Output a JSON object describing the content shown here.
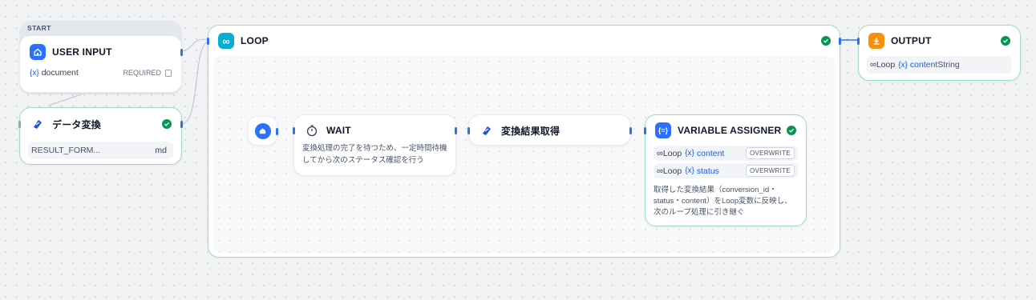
{
  "start_group": {
    "label": "START"
  },
  "user_input": {
    "title": "USER INPUT",
    "icon": "home-icon",
    "color": "#2970ff",
    "variable": "document",
    "variable_icon": "{x}",
    "required_label": "REQUIRED"
  },
  "data_convert": {
    "title": "データ変換",
    "icon": "tool-icon",
    "field_label": "RESULT_FORM...",
    "field_value": "md",
    "status": "success"
  },
  "loop": {
    "title": "LOOP",
    "icon": "infinity-icon",
    "color": "#06aed4",
    "status": "success"
  },
  "loop_start": {
    "icon": "home-icon"
  },
  "wait": {
    "title": "WAIT",
    "icon": "stopwatch-icon",
    "description": "変換処理の完了を待つため、一定時間待機してから次のステータス確認を行う"
  },
  "fetch_result": {
    "title": "変換結果取得",
    "icon": "tool-icon"
  },
  "variable_assigner": {
    "title": "VARIABLE ASSIGNER",
    "icon": "variable-icon",
    "color": "#2970ff",
    "status": "success",
    "assignments": [
      {
        "scope": "Loop",
        "variable": "content",
        "mode": "OVERWRITE"
      },
      {
        "scope": "Loop",
        "variable": "status",
        "mode": "OVERWRITE"
      }
    ],
    "description": "取得した変換結果（conversion_id・status・content）をLoop変数に反映し、次のループ処理に引き継ぐ"
  },
  "output": {
    "title": "OUTPUT",
    "icon": "output-icon",
    "color": "#f79009",
    "status": "success",
    "scope": "Loop",
    "variable": "content",
    "type": "String"
  }
}
